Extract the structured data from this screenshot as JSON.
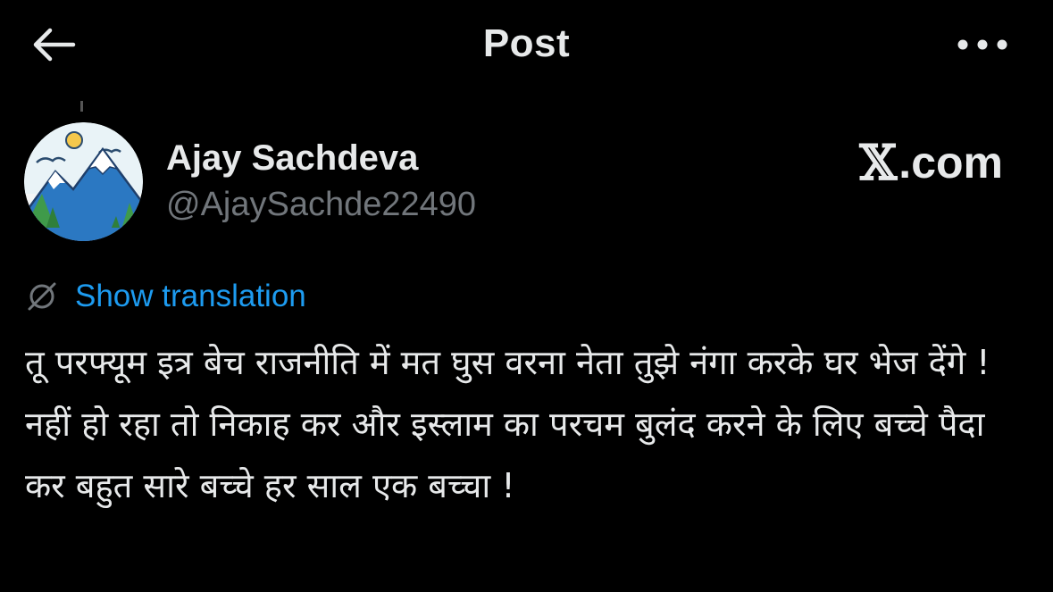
{
  "header": {
    "title": "Post",
    "back_icon": "arrow-left-icon",
    "more_icon": "more-dots-icon"
  },
  "author": {
    "name": "Ajay Sachdeva",
    "handle": "@AjaySachde22490",
    "avatar_icon": "mountain-landscape-avatar"
  },
  "brand": {
    "x_glyph": "𝕏",
    "domain_suffix": ".com"
  },
  "translation": {
    "label": "Show translation",
    "icon": "translate-slash-icon"
  },
  "post": {
    "text": "तू परफ्यूम इत्र बेच राजनीति में मत घुस वरना नेता तुझे नंगा करके घर भेज देंगे ! नहीं हो रहा तो निकाह कर और इस्लाम का परचम बुलंद करने के लिए बच्चे पैदा कर बहुत सारे बच्चे हर साल एक बच्चा !"
  },
  "colors": {
    "background": "#000000",
    "text_primary": "#e7e9ea",
    "text_secondary": "#71767b",
    "link": "#1d9bf0"
  }
}
